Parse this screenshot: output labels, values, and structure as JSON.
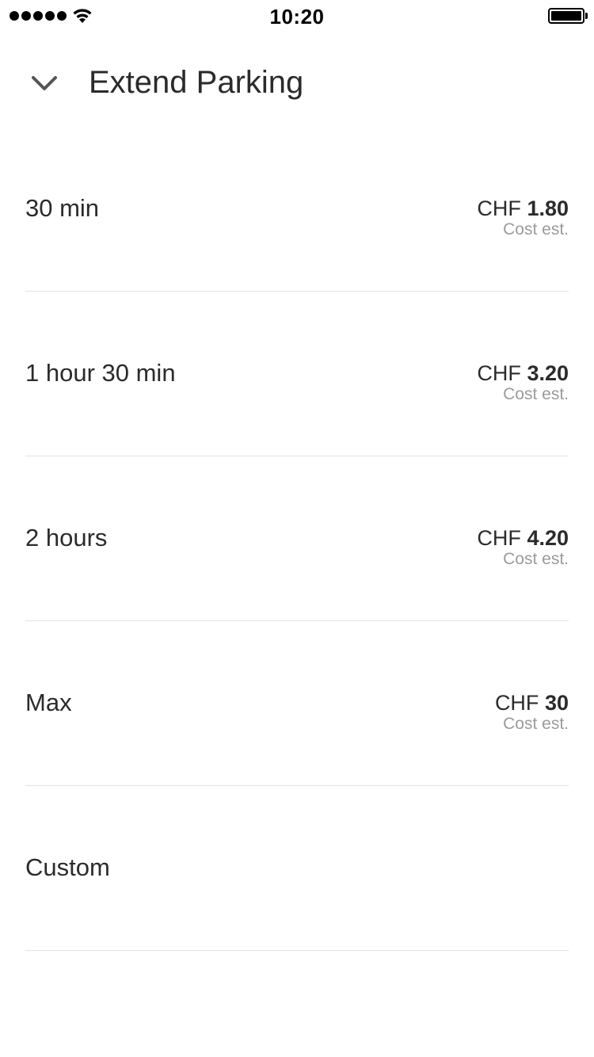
{
  "status_bar": {
    "time": "10:20",
    "signal_icon": "signal-dots-icon",
    "wifi_icon": "wifi-icon",
    "battery_icon": "battery-icon"
  },
  "header": {
    "back_icon": "chevron-down-icon",
    "title": "Extend Parking"
  },
  "options": [
    {
      "label": "30 min",
      "currency": "CHF",
      "amount": "1.80",
      "note": "Cost est."
    },
    {
      "label": "1 hour 30 min",
      "currency": "CHF",
      "amount": "3.20",
      "note": "Cost est."
    },
    {
      "label": "2 hours",
      "currency": "CHF",
      "amount": "4.20",
      "note": "Cost est."
    },
    {
      "label": "Max",
      "currency": "CHF",
      "amount": "30",
      "note": "Cost est."
    },
    {
      "label": "Custom"
    }
  ],
  "colors": {
    "text_primary": "#2b2b2b",
    "text_secondary": "#9b9b9b",
    "divider": "#e3e3e3",
    "background": "#ffffff"
  }
}
